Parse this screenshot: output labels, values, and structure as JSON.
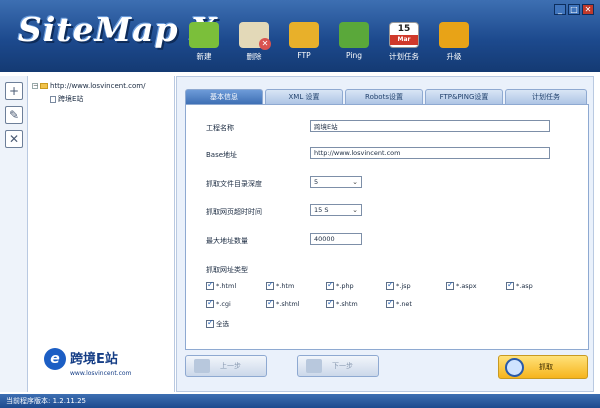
{
  "app": {
    "logo_text": "SiteMap X",
    "status_text": "当前程序版本: 1.2.11.25"
  },
  "window_controls": {
    "minimize": "_",
    "restore": "□",
    "close": "✕"
  },
  "toolbar": [
    {
      "label": "新建",
      "icon": "new-icon",
      "color": "#7bbf3a"
    },
    {
      "label": "删除",
      "icon": "delete-icon",
      "color": "#d9534f"
    },
    {
      "label": "FTP",
      "icon": "ftp-icon",
      "color": "#e8b02a"
    },
    {
      "label": "Ping",
      "icon": "ping-icon",
      "color": "#5aa83a"
    },
    {
      "label": "计划任务",
      "icon": "calendar-icon",
      "color": "#d0392b",
      "cal_top": "15",
      "cal_bottom": "Mar"
    },
    {
      "label": "升级",
      "icon": "upgrade-icon",
      "color": "#e8a317"
    }
  ],
  "tree": {
    "root": "http://www.losvincent.com/",
    "child": "跨境E站"
  },
  "brand": {
    "mark": "e",
    "name": "跨境E站",
    "url": "www.losvincent.com"
  },
  "tabs": [
    "基本信息",
    "XML 设置",
    "Robots设置",
    "FTP&PING设置",
    "计划任务"
  ],
  "form": {
    "project_name_label": "工程名称",
    "project_name_value": "跨境E站",
    "base_url_label": "Base地址",
    "base_url_value": "http://www.losvincent.com",
    "depth_label": "抓取文件目录深度",
    "depth_value": "5",
    "timeout_label": "抓取网页超时时间",
    "timeout_value": "15 S",
    "max_urls_label": "最大地址数量",
    "max_urls_value": "40000",
    "types_label": "抓取网址类型",
    "types": [
      {
        "label": "*.html",
        "checked": true
      },
      {
        "label": "*.htm",
        "checked": true
      },
      {
        "label": "*.php",
        "checked": true
      },
      {
        "label": "*.jsp",
        "checked": true
      },
      {
        "label": "*.aspx",
        "checked": true
      },
      {
        "label": "*.asp",
        "checked": true
      },
      {
        "label": "*.cgi",
        "checked": true
      },
      {
        "label": "*.shtml",
        "checked": true
      },
      {
        "label": "*.shtm",
        "checked": true
      },
      {
        "label": "*.net",
        "checked": true
      }
    ],
    "select_all_label": "全选",
    "select_all_checked": true
  },
  "nav": {
    "prev": "上一步",
    "next": "下一步",
    "capture": "抓取"
  }
}
